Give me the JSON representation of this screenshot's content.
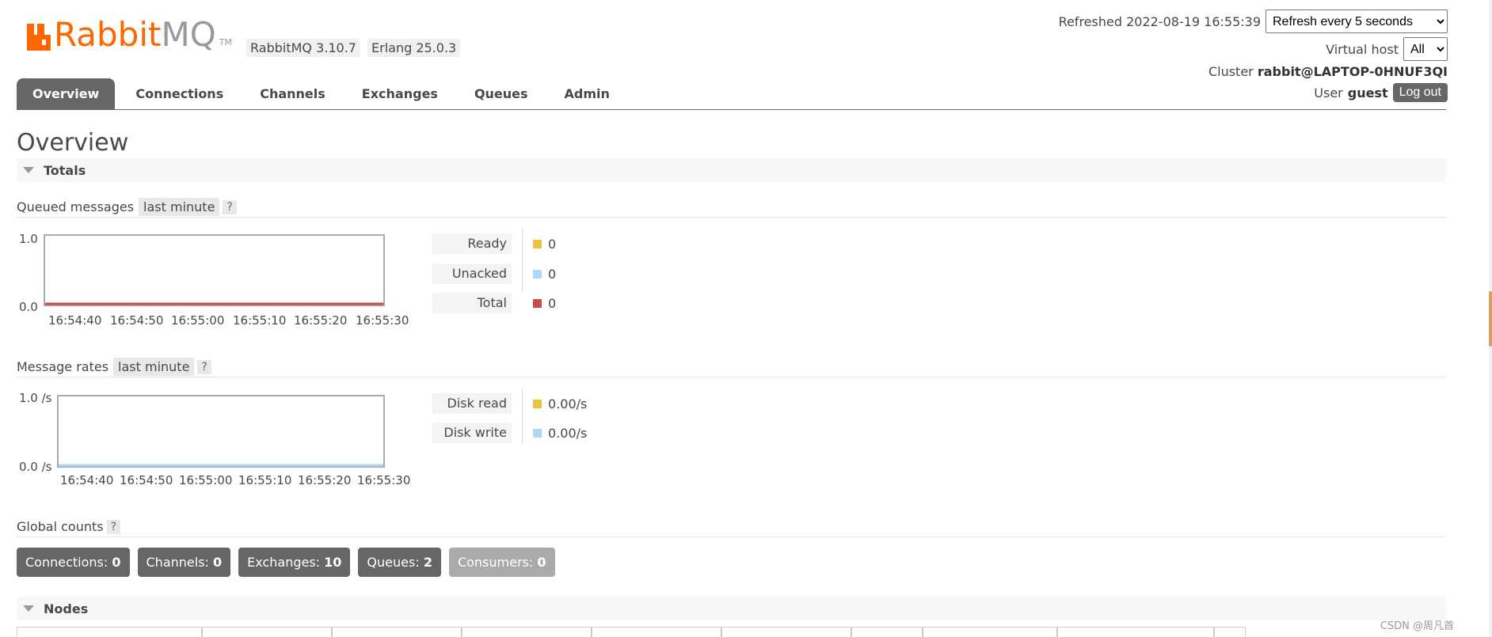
{
  "logo": {
    "word1": "Rabbit",
    "word2": "MQ",
    "tm": "TM"
  },
  "versions": {
    "rabbitmq": "RabbitMQ 3.10.7",
    "erlang": "Erlang 25.0.3"
  },
  "header": {
    "refreshed_label": "Refreshed 2022-08-19 16:55:39",
    "refresh_option": "Refresh every 5 seconds",
    "vhost_label": "Virtual host",
    "vhost_value": "All",
    "cluster_label": "Cluster",
    "cluster_name": "rabbit@LAPTOP-0HNUF3QI",
    "user_label": "User",
    "user_name": "guest",
    "logout": "Log out"
  },
  "tabs": [
    {
      "label": "Overview",
      "active": true
    },
    {
      "label": "Connections"
    },
    {
      "label": "Channels"
    },
    {
      "label": "Exchanges"
    },
    {
      "label": "Queues"
    },
    {
      "label": "Admin"
    }
  ],
  "page_title": "Overview",
  "totals": {
    "header": "Totals",
    "queued": {
      "label": "Queued messages",
      "range": "last minute",
      "help": "?",
      "y_top": "1.0",
      "y_bottom": "0.0",
      "x_ticks": [
        "16:54:40",
        "16:54:50",
        "16:55:00",
        "16:55:10",
        "16:55:20",
        "16:55:30"
      ],
      "legend": [
        {
          "key": "Ready",
          "value": "0",
          "color": "#edc240"
        },
        {
          "key": "Unacked",
          "value": "0",
          "color": "#afd8f8"
        },
        {
          "key": "Total",
          "value": "0",
          "color": "#cb4b4b"
        }
      ]
    },
    "rates": {
      "label": "Message rates",
      "range": "last minute",
      "help": "?",
      "y_top": "1.0 /s",
      "y_bottom": "0.0 /s",
      "x_ticks": [
        "16:54:40",
        "16:54:50",
        "16:55:00",
        "16:55:10",
        "16:55:20",
        "16:55:30"
      ],
      "legend": [
        {
          "key": "Disk read",
          "value": "0.00/s",
          "color": "#edc240"
        },
        {
          "key": "Disk write",
          "value": "0.00/s",
          "color": "#afd8f8"
        }
      ]
    },
    "global": {
      "label": "Global counts",
      "help": "?",
      "counts": [
        {
          "key": "Connections:",
          "value": "0"
        },
        {
          "key": "Channels:",
          "value": "0"
        },
        {
          "key": "Exchanges:",
          "value": "10"
        },
        {
          "key": "Queues:",
          "value": "2"
        },
        {
          "key": "Consumers:",
          "value": "0"
        }
      ]
    }
  },
  "nodes": {
    "header": "Nodes"
  },
  "watermark": "CSDN @周凡首"
}
